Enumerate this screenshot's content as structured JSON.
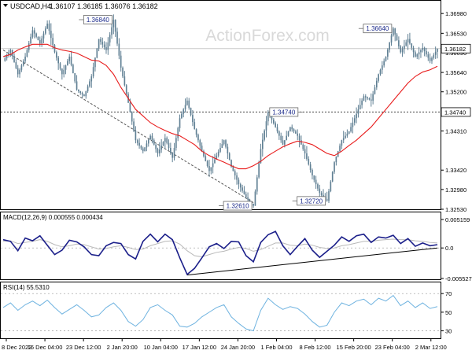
{
  "header": {
    "symbol": "USDCAD,H4",
    "ohlc": "1.36107 1.36185 1.36076 1.36182"
  },
  "watermark": "ActionForex.com",
  "colors": {
    "candle": "#5f7f93",
    "ema": "#e81c1c",
    "price_line": "#c8c8c8",
    "macd": "#1b1f8a",
    "signal": "#b9b9b9",
    "rsi": "#6fb3e0",
    "axis": "#000000",
    "watermark": "#d9d9d9",
    "callout_text": "#1b2a8a",
    "grid": "#999999"
  },
  "chart_data": [
    {
      "type": "line",
      "panel": "price",
      "ylim": [
        1.3253,
        1.3718
      ],
      "yticks": [
        "1.36980",
        "1.36530",
        "1.36090",
        "1.35640",
        "1.35200",
        "1.34740",
        "1.34310",
        "1.33420",
        "1.32980",
        "1.32530"
      ],
      "current_price": 1.36182,
      "current_price_label": "1.36182",
      "level": 1.3474,
      "level_label": "1.34740",
      "price_path": [
        1.359,
        1.3615,
        1.356,
        1.36,
        1.366,
        1.363,
        1.3675,
        1.361,
        1.356,
        1.36,
        1.3525,
        1.351,
        1.3555,
        1.364,
        1.3615,
        1.3684,
        1.3575,
        1.3495,
        1.341,
        1.3385,
        1.342,
        1.338,
        1.3415,
        1.337,
        1.346,
        1.35,
        1.3435,
        1.3385,
        1.334,
        1.3375,
        1.341,
        1.335,
        1.331,
        1.328,
        1.3261,
        1.339,
        1.3474,
        1.344,
        1.34,
        1.344,
        1.342,
        1.338,
        1.333,
        1.329,
        1.3272,
        1.336,
        1.341,
        1.343,
        1.347,
        1.351,
        1.35,
        1.356,
        1.36,
        1.3664,
        1.361,
        1.364,
        1.36,
        1.362,
        1.359,
        1.3618
      ],
      "ema_path": [
        1.36,
        1.3605,
        1.3615,
        1.3622,
        1.3628,
        1.3628,
        1.3628,
        1.362,
        1.3615,
        1.3612,
        1.3608,
        1.36,
        1.3592,
        1.359,
        1.358,
        1.356,
        1.353,
        1.3505,
        1.348,
        1.3465,
        1.345,
        1.344,
        1.3432,
        1.3425,
        1.342,
        1.341,
        1.34,
        1.3385,
        1.3375,
        1.3367,
        1.336,
        1.3352,
        1.3345,
        1.3345,
        1.3352,
        1.3362,
        1.3375,
        1.3385,
        1.3395,
        1.3402,
        1.3408,
        1.3405,
        1.34,
        1.339,
        1.338,
        1.3375,
        1.3385,
        1.3398,
        1.341,
        1.3425,
        1.344,
        1.346,
        1.348,
        1.35,
        1.352,
        1.354,
        1.3555,
        1.3565,
        1.357,
        1.3578
      ],
      "callouts": [
        {
          "label": "1.36840",
          "value": 1.3684,
          "idx": 15,
          "side": "left"
        },
        {
          "label": "1.36640",
          "value": 1.3664,
          "idx": 53,
          "side": "left"
        },
        {
          "label": "1.34740",
          "value": 1.3474,
          "idx": 36,
          "side": "right"
        },
        {
          "label": "1.32610",
          "value": 1.3261,
          "idx": 34,
          "side": "left"
        },
        {
          "label": "1.32720",
          "value": 1.3272,
          "idx": 44,
          "side": "left"
        }
      ],
      "trendline": {
        "from": [
          0,
          1.3615
        ],
        "to": [
          34,
          1.3268
        ]
      }
    },
    {
      "type": "line",
      "panel": "macd",
      "title": "MACD(12,26,9) 0.000555 0.000434",
      "ylim": [
        -0.00553,
        0.00516
      ],
      "yticks": [
        "0.005159",
        "0.0",
        "-0.005527"
      ],
      "macd": [
        0.0015,
        0.0012,
        -0.0005,
        0.0018,
        0.0013,
        0.0022,
        0.0005,
        -0.0012,
        -0.0004,
        0.0014,
        0.0011,
        0.0002,
        -0.0012,
        -0.0014,
        0.0004,
        0.001,
        0.0008,
        -0.0012,
        -0.002,
        0.0012,
        0.0025,
        0.0011,
        0.0025,
        0.0015,
        -0.0018,
        -0.0048,
        -0.0037,
        -0.0018,
        0.0002,
        0.0008,
        -0.0001,
        0.0012,
        0.0011,
        -0.0014,
        -0.0025,
        0.001,
        0.0024,
        0.003,
        0.0004,
        -0.0012,
        0.0003,
        0.0017,
        -0.0004,
        -0.0017,
        -0.0006,
        0.0005,
        0.002,
        0.0012,
        0.0022,
        0.0025,
        0.001,
        0.002,
        0.0018,
        0.0023,
        0.0008,
        0.0017,
        0.0003,
        0.0009,
        0.0004,
        0.0006
      ],
      "signal": [
        0.0012,
        0.0013,
        0.0008,
        0.001,
        0.0012,
        0.0015,
        0.0012,
        0.0006,
        0.0002,
        0.0004,
        0.0007,
        0.0006,
        0.0002,
        -0.0002,
        -0.0001,
        0.0002,
        0.0004,
        0.0001,
        -0.0003,
        -0.0002,
        0.0004,
        0.0008,
        0.0012,
        0.0013,
        0.0007,
        -0.0005,
        -0.0014,
        -0.0016,
        -0.0012,
        -0.0008,
        -0.0006,
        -0.0002,
        0.0001,
        -0.0001,
        -0.0006,
        -0.0003,
        0.0003,
        0.0009,
        0.0009,
        0.0005,
        0.0004,
        0.0007,
        0.0005,
        0.0001,
        -0.0001,
        0.0,
        0.0004,
        0.0006,
        0.0009,
        0.0012,
        0.0012,
        0.0014,
        0.0015,
        0.0016,
        0.0015,
        0.0015,
        0.0013,
        0.0012,
        0.001,
        0.0009
      ],
      "trendline": {
        "from": [
          25,
          -0.0049
        ],
        "to": [
          59,
          0.0
        ]
      }
    },
    {
      "type": "line",
      "panel": "rsi",
      "title": "RSI(14) 55.5310",
      "ylim": [
        22,
        82
      ],
      "yticks": [
        "70",
        "50",
        "30"
      ],
      "values": [
        55,
        60,
        52,
        58,
        62,
        57,
        63,
        55,
        48,
        53,
        58,
        52,
        45,
        47,
        55,
        60,
        52,
        40,
        35,
        42,
        55,
        58,
        52,
        47,
        35,
        34,
        38,
        45,
        50,
        55,
        58,
        45,
        38,
        32,
        30,
        52,
        65,
        58,
        53,
        56,
        54,
        48,
        40,
        34,
        36,
        50,
        60,
        57,
        62,
        64,
        58,
        65,
        62,
        68,
        57,
        62,
        55,
        60,
        54,
        56
      ]
    },
    {
      "type": "table",
      "panel": "x-axis",
      "x_labels": [
        "8 Dec 2022",
        "16 Dec 04:00",
        "23 Dec 12:00",
        "2 Jan 20:00",
        "10 Jan 04:00",
        "17 Jan 12:00",
        "24 Jan 20:00",
        "1 Feb 04:00",
        "8 Feb 12:00",
        "15 Feb 20:00",
        "23 Feb 04:00",
        "2 Mar 12:00"
      ]
    }
  ]
}
